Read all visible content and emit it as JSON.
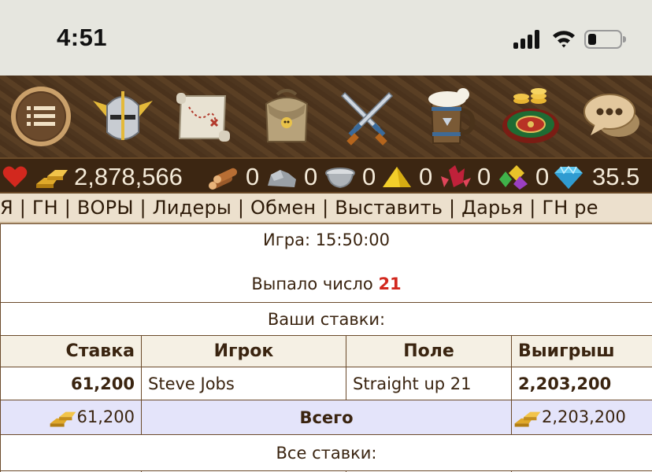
{
  "status_bar": {
    "time": "4:51"
  },
  "game_nav": {
    "icons": [
      "menu-icon",
      "knight-helmet-icon",
      "treasure-map-icon",
      "backpack-icon",
      "crossed-swords-icon",
      "tavern-mug-icon",
      "roulette-icon",
      "chat-bubbles-icon"
    ]
  },
  "resources": {
    "gold": "2,878,566",
    "wood": "0",
    "stone": "0",
    "metal": "0",
    "sulfur": "0",
    "crystal": "0",
    "gems": "0",
    "diamonds": "35.5"
  },
  "links": [
    "Я",
    "ГН",
    "ВОРЫ",
    "Лидеры",
    "Обмен",
    "Выставить",
    "Дарья",
    "ГН ре"
  ],
  "game": {
    "time_label": "Игра: 15:50:00",
    "result_label": "Выпало число",
    "result_number": "21",
    "your_bets_title": "Ваши ставки:",
    "all_bets_title": "Все ставки:",
    "headers": {
      "bet": "Ставка",
      "player": "Игрок",
      "field": "Поле",
      "win": "Выигрыш"
    },
    "rows": [
      {
        "bet": "61,200",
        "player": "Steve Jobs",
        "field": "Straight up 21",
        "win": "2,203,200"
      }
    ],
    "total": {
      "bet": "61,200",
      "label": "Всего",
      "win": "2,203,200"
    }
  }
}
